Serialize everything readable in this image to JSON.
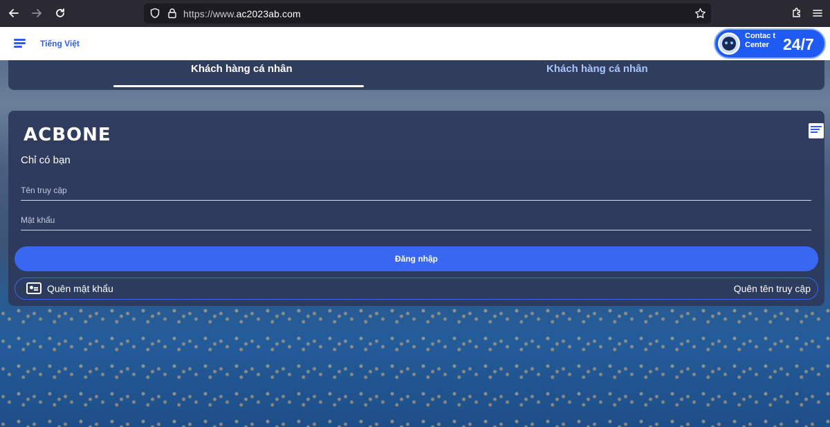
{
  "browser": {
    "url_prefix": "https://www.",
    "url_domain": "ac2023ab.com"
  },
  "header": {
    "language": "Tiếng Việt",
    "contact_label": "Contac t Center",
    "contact_hours": "24/7",
    "accent": "#2f5ce8"
  },
  "tabs": [
    {
      "label": "Khách hàng cá nhân",
      "active": true
    },
    {
      "label": "Khách hàng cá nhân",
      "active": false
    }
  ],
  "login": {
    "logo": "ACBONE",
    "tagline": "Chỉ có bạn",
    "username_placeholder": "Tên truy cập",
    "password_placeholder": "Mật khẩu",
    "submit_label": "Đăng nhập",
    "forgot_password": "Quên mật khẩu",
    "forgot_username": "Quên tên truy cập",
    "button_color": "#3a67f2"
  }
}
